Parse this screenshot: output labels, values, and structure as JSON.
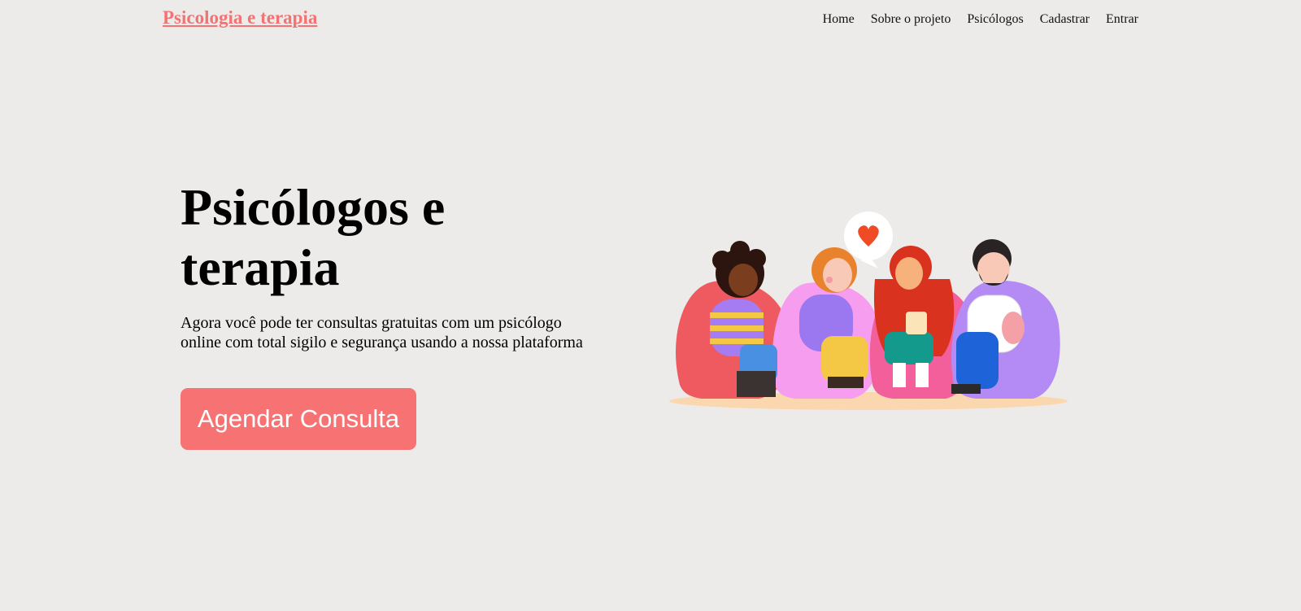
{
  "header": {
    "brand": "Psicologia e terapia",
    "nav": {
      "home": "Home",
      "about": "Sobre o projeto",
      "psychologists": "Psicólogos",
      "register": "Cadastrar",
      "login": "Entrar"
    }
  },
  "hero": {
    "title": "Psicólogos e terapia",
    "description": "Agora você pode ter consultas gratuitas com um psicólogo online com total sigilo e segurança usando a nossa plataforma",
    "cta_label": "Agendar Consulta"
  },
  "colors": {
    "background": "#edebe9",
    "accent": "#f77373",
    "brand": "#f47272"
  },
  "illustration": {
    "icon": "group-therapy-illustration"
  }
}
